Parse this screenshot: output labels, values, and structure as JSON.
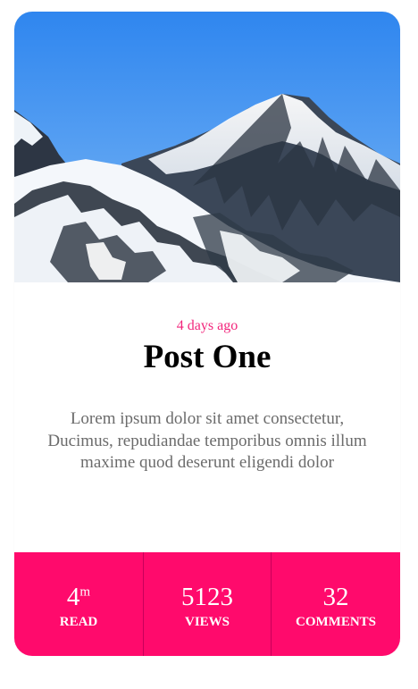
{
  "card": {
    "image_alt": "Snow-covered mountain range under blue sky",
    "date": "4 days ago",
    "title": "Post One",
    "excerpt": "Lorem ipsum dolor sit amet consectetur, Ducimus, repudiandae temporibus omnis illum maxime quod deserunt eligendi dolor",
    "stats": [
      {
        "value": "4",
        "unit": "m",
        "label": "READ"
      },
      {
        "value": "5123",
        "unit": "",
        "label": "VIEWS"
      },
      {
        "value": "32",
        "unit": "",
        "label": "COMMENTS"
      }
    ]
  },
  "colors": {
    "accent": "#ff0a6c",
    "date_text": "#f2247b",
    "sky": "#3f8ff0"
  }
}
